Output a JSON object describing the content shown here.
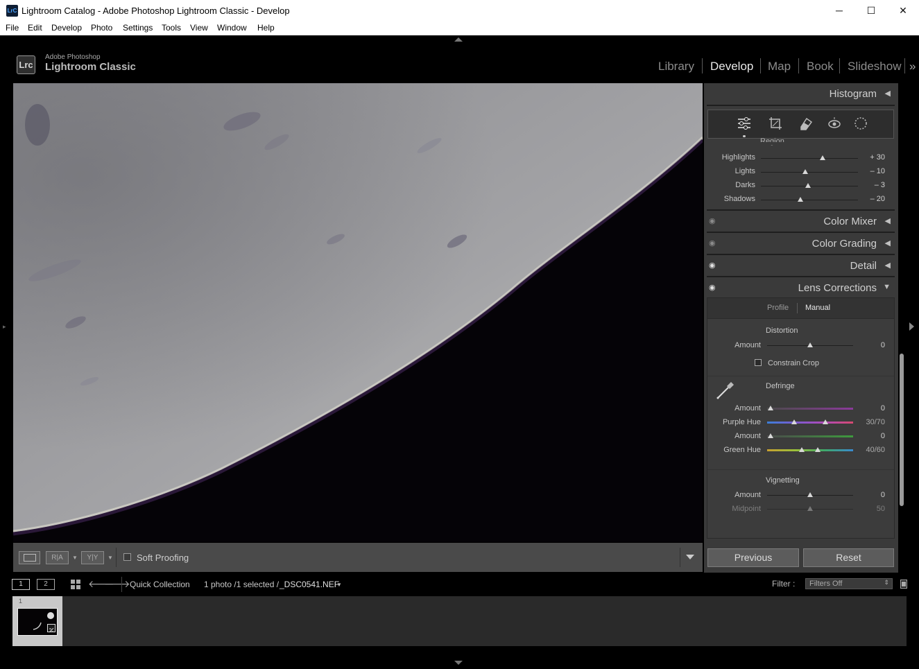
{
  "window": {
    "title": "Lightroom Catalog - Adobe Photoshop Lightroom Classic - Develop",
    "icon_text": "LrC",
    "min": "─",
    "max": "☐",
    "close": "✕"
  },
  "menu": [
    "File",
    "Edit",
    "Develop",
    "Photo",
    "Settings",
    "Tools",
    "View",
    "Window",
    "Help"
  ],
  "brand": {
    "badge": "Lrc",
    "line1": "Adobe Photoshop",
    "line2": "Lightroom Classic"
  },
  "modules": [
    "Library",
    "Develop",
    "Map",
    "Book",
    "Slideshow"
  ],
  "module_more": "»",
  "panels": {
    "histogram": "Histogram",
    "region_label": "Region",
    "tone": [
      {
        "label": "Highlights",
        "value": "+ 30",
        "pos": 0.64
      },
      {
        "label": "Lights",
        "value": "– 10",
        "pos": 0.46
      },
      {
        "label": "Darks",
        "value": "– 3",
        "pos": 0.49
      },
      {
        "label": "Shadows",
        "value": "– 20",
        "pos": 0.41
      }
    ],
    "color_mixer": "Color Mixer",
    "color_grading": "Color Grading",
    "detail": "Detail",
    "lens_corrections": "Lens Corrections",
    "tabs": {
      "profile": "Profile",
      "manual": "Manual"
    },
    "distortion": {
      "title": "Distortion",
      "amount_label": "Amount",
      "amount_value": "0",
      "constrain": "Constrain Crop"
    },
    "defringe": {
      "title": "Defringe",
      "purple_amount_label": "Amount",
      "purple_amount_value": "0",
      "purple_hue_label": "Purple Hue",
      "purple_hue_value": "30/70",
      "green_amount_label": "Amount",
      "green_amount_value": "0",
      "green_hue_label": "Green Hue",
      "green_hue_value": "40/60"
    },
    "vignetting": {
      "title": "Vignetting",
      "amount_label": "Amount",
      "amount_value": "0",
      "midpoint_label": "Midpoint",
      "midpoint_value": "50"
    }
  },
  "toolbar": {
    "ra": "R|A",
    "yy": "Y|Y",
    "soft_proofing": "Soft Proofing"
  },
  "buttons": {
    "previous": "Previous",
    "reset": "Reset"
  },
  "filmbar": {
    "screen1": "1",
    "screen2": "2",
    "collection": "Quick Collection",
    "count": "1 photo /1 selected /",
    "filename": "_DSC0541.NEF",
    "filter_label": "Filter :",
    "filter_value": "Filters Off"
  },
  "filmstrip": {
    "index": "1"
  },
  "colors": {
    "panel": "#3a3a3a",
    "active_module": "#e8e8e8",
    "inactive_module": "#8c8c8c"
  }
}
